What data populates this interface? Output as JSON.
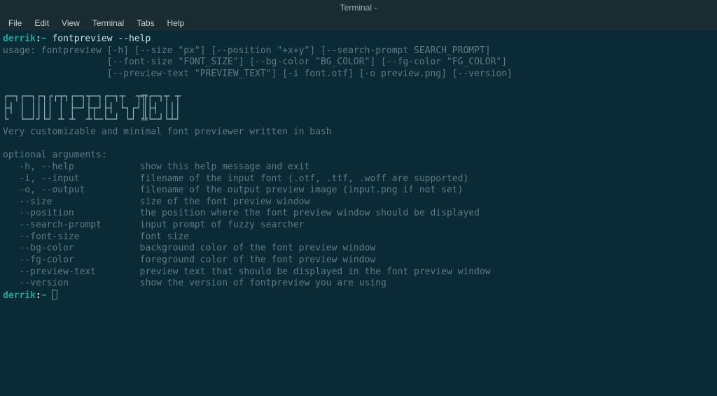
{
  "window": {
    "title": "Terminal -"
  },
  "menu": {
    "file": "File",
    "edit": "Edit",
    "view": "View",
    "terminal": "Terminal",
    "tabs": "Tabs",
    "help": "Help"
  },
  "prompt": {
    "user": "derrik",
    "sep": ":",
    "tilde": "~",
    "sp": " ",
    "command": "fontpreview --help"
  },
  "usage": {
    "l1": "usage: fontpreview [-h] [--size \"px\"] [--position \"+x+y\"] [--search-prompt SEARCH_PROMPT]",
    "l2": "                   [--font-size \"FONT_SIZE\"] [--bg-color \"BG_COLOR\"] [--fg-color \"FG_COLOR\"]",
    "l3": "                   [--preview-text \"PREVIEW_TEXT\"] [-i font.otf] [-o preview.png] [--version]"
  },
  "ascii": {
    "l1": "┌─┐┌─┐┌┐┌┌┬┐┌─┐┬─┐┌─┐┬  ┬╦┌─┐┬ ┬",
    "l2": "├┤ │ ││││ │ ├─┘├┬┘├┤ └┐┌┘║├┤ │││",
    "l3": "└  └─┘┘└┘ ┴ ┴  ┴└─└─┘ └┘ ╩└─┘└┴┘"
  },
  "desc": "Very customizable and minimal font previewer written in bash",
  "opt_header": "optional arguments:",
  "opts": {
    "help": "   -h, --help            show this help message and exit",
    "input": "   -i, --input           filename of the input font (.otf, .ttf, .woff are supported)",
    "output": "   -o, --output          filename of the output preview image (input.png if not set)",
    "size": "   --size                size of the font preview window",
    "position": "   --position            the position where the font preview window should be displayed",
    "search": "   --search-prompt       input prompt of fuzzy searcher",
    "fontsize": "   --font-size           font size",
    "bg": "   --bg-color            background color of the font preview window",
    "fg": "   --fg-color            foreground color of the font preview window",
    "preview": "   --preview-text        preview text that should be displayed in the font preview window",
    "version": "   --version             show the version of fontpreview you are using"
  }
}
